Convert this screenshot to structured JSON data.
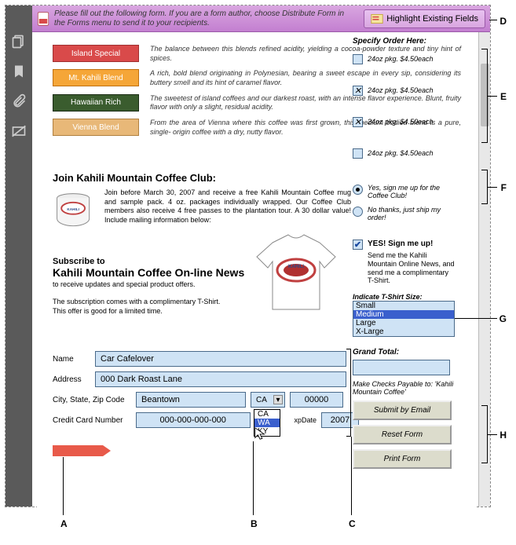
{
  "topbar": {
    "message": "Please fill out the following form. If you are a form author, choose Distribute Form in the Forms menu to send it to your recipients.",
    "highlight_button": "Highlight Existing Fields"
  },
  "order_header": "Specify Order Here:",
  "coffees": [
    {
      "name": "Island Special",
      "swatch": "sw-red",
      "desc": "The balance between this blends refined acidity, yielding a cocoa-powder texture and tiny hint of spices.",
      "price": "24oz pkg. $4.50each",
      "checked": false
    },
    {
      "name": "Mt. Kahili  Blend",
      "swatch": "sw-orange",
      "desc": "A rich, bold blend originating in Polynesian, bearing a sweet escape in every sip, considering its buttery smell and its hint of caramel flavor.",
      "price": "24oz pkg. $4.50each",
      "checked": true
    },
    {
      "name": "Hawaiian Rich",
      "swatch": "sw-green",
      "desc": "The sweetest of island coffees and our darkest roast, with an intense flavor experience. Blunt, fruity flavor with only a slight, residual acidity.",
      "price": "24oz pkg. $4.50each",
      "checked": true
    },
    {
      "name": "Vienna Blend",
      "swatch": "sw-tan",
      "desc": "From the area of Vienna where this coffee was first grown, this medium bodied blend is a pure, single- origin coffee with a dry, nutty flavor.",
      "price": "24oz pkg. $4.50each",
      "checked": false
    }
  ],
  "club": {
    "heading": "Join Kahili Mountain Coffee Club:",
    "body": "Join before March 30, 2007 and receive a free Kahili Mountain Coffee mug and sample pack. 4 oz. packages individually wrapped. Our Coffee Club members also receive 4 free passes to the plantation tour. A 30 dollar value! Include mailing information below:"
  },
  "radios": {
    "yes": "Yes, sign me up for the Coffee Club!",
    "no": "No thanks, just ship my order!",
    "selected": "yes"
  },
  "signup": {
    "heading": "YES! Sign me up!",
    "body": "Send me the Kahili Mountain Online News, and send me a complimentary T-Shirt.",
    "checked": true,
    "size_label": "Indicate T-Shirt Size:",
    "sizes": [
      "Small",
      "Medium",
      "Large",
      "X-Large"
    ],
    "selected_size": "Medium"
  },
  "news": {
    "line1": "Subscribe to",
    "line2": "Kahili Mountain Coffee On-line News",
    "sub": "to receive updates and special product offers.",
    "note1": "The subscription comes with a complimentary T-Shirt.",
    "note2": "This offer is good for a limited time."
  },
  "address": {
    "name_label": "Name",
    "name": "Car Cafelover",
    "addr_label": "Address",
    "addr": "000 Dark Roast Lane",
    "csz_label": "City, State, Zip Code",
    "city": "Beantown",
    "state": "CA",
    "state_options": [
      "CA",
      "WA",
      "KY"
    ],
    "state_hover": "WA",
    "zip": "00000",
    "cc_label": "Credit Card Number",
    "cc": "000-000-000-000",
    "exp_label": "xpDate",
    "exp": "2007"
  },
  "totals": {
    "label": "Grand Total:",
    "value": "",
    "payable": "Make Checks Payable to: 'Kahili Mountain Coffee'"
  },
  "buttons": {
    "submit": "Submit by Email",
    "reset": "Reset Form",
    "print": "Print Form"
  },
  "callouts": {
    "A": "A",
    "B": "B",
    "C": "C",
    "D": "D",
    "E": "E",
    "F": "F",
    "G": "G",
    "H": "H"
  }
}
